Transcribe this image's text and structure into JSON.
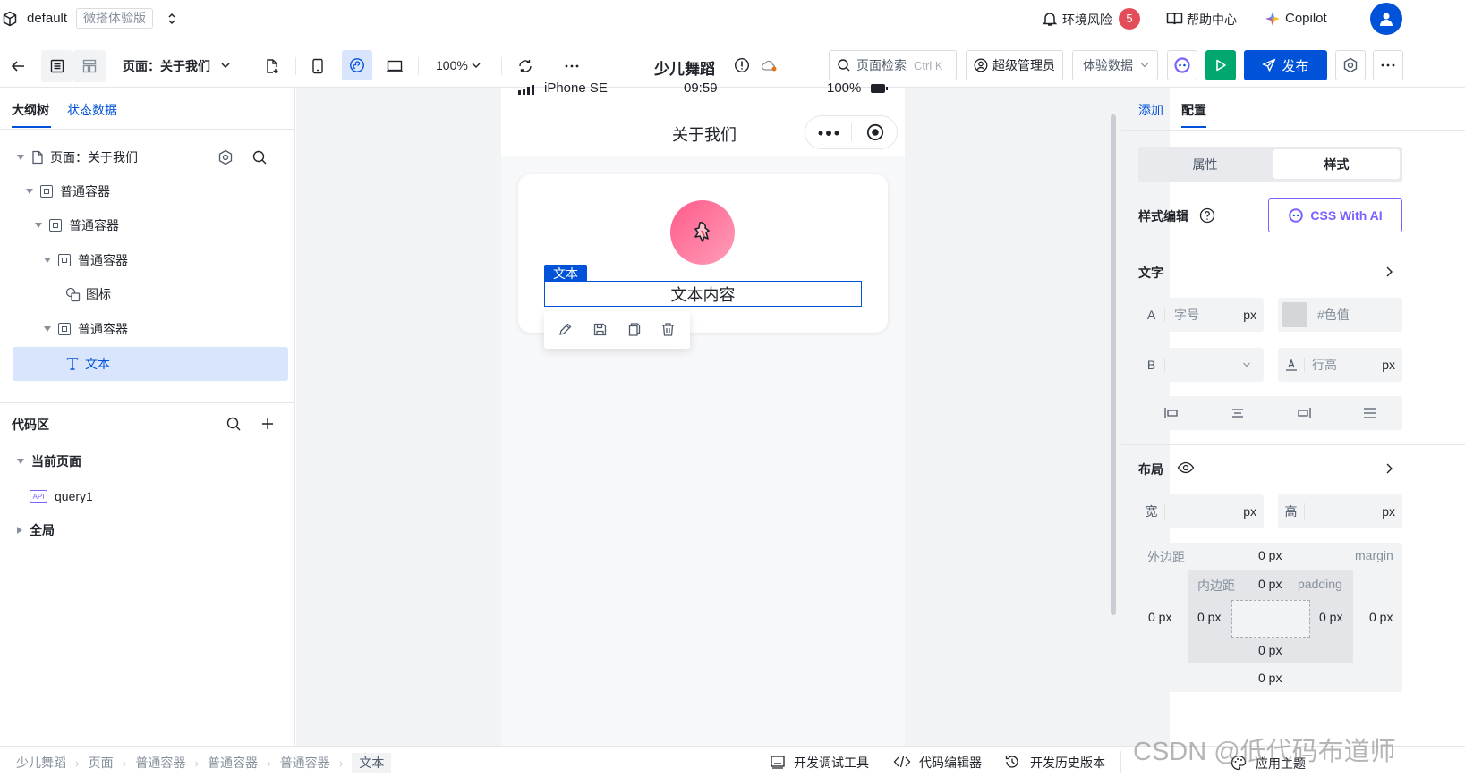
{
  "topbar": {
    "app_name": "default",
    "edition_badge": "微搭体验版",
    "env_risk_label": "环境风险",
    "env_risk_count": "5",
    "help_label": "帮助中心",
    "copilot_label": "Copilot"
  },
  "toolbar": {
    "page_selector": "页面：关于我们",
    "zoom": "100%",
    "app_title": "少儿舞蹈",
    "search_placeholder": "页面检索",
    "search_shortcut": "Ctrl K",
    "role_label": "超级管理员",
    "data_mode": "体验数据",
    "publish_label": "发布"
  },
  "left": {
    "tabs": [
      "大纲树",
      "状态数据"
    ],
    "tree": {
      "page": "页面：关于我们",
      "c1": "普通容器",
      "c2": "普通容器",
      "c3": "普通容器",
      "icon": "图标",
      "c4": "普通容器",
      "text": "文本"
    },
    "code": {
      "title": "代码区",
      "current_page": "当前页面",
      "api_badge": "API",
      "query": "query1",
      "global": "全局"
    }
  },
  "canvas": {
    "device": "iPhone SE",
    "time": "09:59",
    "battery": "100%",
    "nav_title": "关于我们",
    "selected_tag": "文本",
    "text_content": "文本内容"
  },
  "right": {
    "tabs": [
      "添加",
      "配置"
    ],
    "seg": [
      "属性",
      "样式"
    ],
    "style_edit": "样式编辑",
    "css_ai": "CSS With AI",
    "text_section": "文字",
    "a_label": "A",
    "font_size_placeholder": "字号",
    "unit_px": "px",
    "color_placeholder": "#色值",
    "b_label": "B",
    "line_height_placeholder": "行高",
    "layout_section": "布局",
    "width_label": "宽",
    "height_label": "高",
    "margin_label": "外边距",
    "margin_en": "margin",
    "padding_label": "内边距",
    "padding_en": "padding",
    "zero_px": "0 px"
  },
  "bottom": {
    "breadcrumb": [
      "少儿舞蹈",
      "页面",
      "普通容器",
      "普通容器",
      "普通容器",
      "文本"
    ],
    "debug_tool": "开发调试工具",
    "code_editor": "代码编辑器",
    "history": "开发历史版本",
    "apply_theme": "应用主题",
    "watermark": "CSDN @低代码布道师"
  },
  "colors": {
    "primary": "#0052d9",
    "publish_green": "#00a870",
    "danger": "#e34d59",
    "selected_row": "#d9e5fc"
  }
}
